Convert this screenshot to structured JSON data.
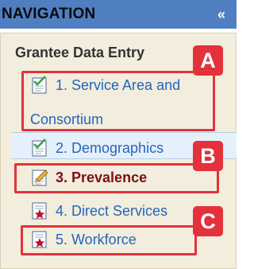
{
  "nav": {
    "title": "NAVIGATION",
    "collapse_glyph": "«"
  },
  "section": {
    "title": "Grantee Data Entry"
  },
  "items": [
    {
      "line1": "1. Service Area and",
      "line2": "Consortium",
      "icon": "checked-document-icon"
    },
    {
      "label": "2. Demographics",
      "icon": "checked-document-icon"
    },
    {
      "label": "3. Prevalence",
      "icon": "pencil-document-icon",
      "active": true
    },
    {
      "label": "4. Direct Services",
      "icon": "star-document-icon"
    },
    {
      "label": "5. Workforce",
      "icon": "star-document-icon"
    }
  ],
  "annotations": {
    "a": "A",
    "b": "B",
    "c": "C"
  },
  "colors": {
    "header": "#4f7fc0",
    "panel": "#f2eddd",
    "link": "#2266bb",
    "active_text": "#7a1016",
    "annotation": "#e3323b"
  }
}
